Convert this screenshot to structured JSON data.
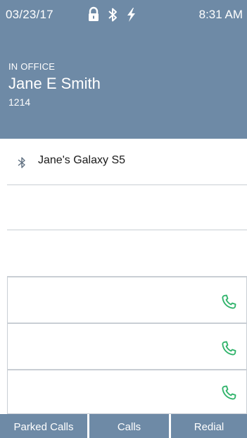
{
  "status_bar": {
    "date": "03/23/17",
    "time": "8:31 AM",
    "icons": [
      "lock-icon",
      "bluetooth-icon",
      "bolt-icon"
    ]
  },
  "header": {
    "presence": "IN OFFICE",
    "name": "Jane E Smith",
    "extension": "1214"
  },
  "lines": [
    {
      "icon": "bluetooth-icon",
      "label": "Jane's Galaxy S5"
    },
    {
      "icon": "",
      "label": ""
    },
    {
      "icon": "",
      "label": ""
    },
    {
      "icon": "phone-icon",
      "label": ""
    },
    {
      "icon": "phone-icon",
      "label": ""
    },
    {
      "icon": "phone-icon",
      "label": ""
    }
  ],
  "softkeys": [
    {
      "label": "Parked Calls"
    },
    {
      "label": "Calls"
    },
    {
      "label": "Redial"
    }
  ],
  "colors": {
    "header_bg": "#6e8aa6",
    "call_icon": "#2fb36a",
    "divider": "#c9ced4"
  }
}
